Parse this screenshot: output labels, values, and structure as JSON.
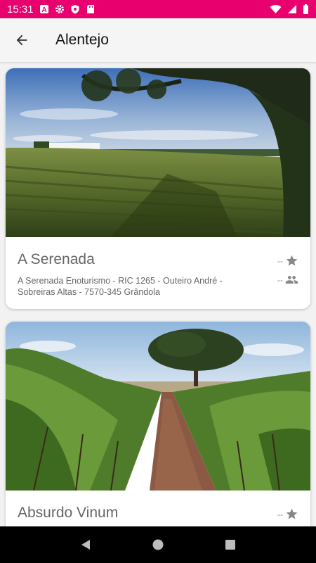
{
  "status_bar": {
    "time": "15:31",
    "left_icons": [
      "app-a-icon",
      "gear-icon",
      "shield-icon",
      "sd-card-icon"
    ],
    "right_icons": [
      "wifi-icon",
      "signal-icon",
      "battery-icon"
    ],
    "color": "#e8006f"
  },
  "app_bar": {
    "title": "Alentejo",
    "back_icon": "arrow-back-icon"
  },
  "cards": [
    {
      "name": "A Serenada",
      "address": "A Serenada Enoturismo - RIC 1265 - Outeiro André - Sobreiras Altas - 7570-345 Grândola",
      "rating": "--",
      "visitors": "--",
      "image": "vineyard-landscape-image"
    },
    {
      "name": "Absurdo Vinum",
      "rating": "--",
      "image": "vineyard-rows-tree-image"
    }
  ],
  "nav_bar": {
    "buttons": [
      "back-triangle-icon",
      "home-circle-icon",
      "recents-square-icon"
    ]
  }
}
